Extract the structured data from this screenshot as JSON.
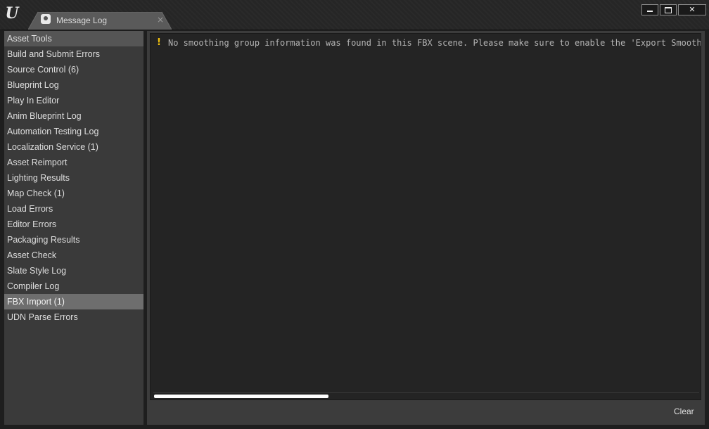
{
  "window": {
    "logo_glyph": "U",
    "logo_icon": "unreal-logo-icon",
    "controls": {
      "minimize_icon": "minimize-icon",
      "maximize_icon": "maximize-icon",
      "close_glyph": "✕"
    }
  },
  "tab": {
    "label": "Message Log",
    "icon": "message-log-icon",
    "close_glyph": "×"
  },
  "sidebar": {
    "items": [
      {
        "label": "Asset Tools",
        "state": "header"
      },
      {
        "label": "Build and Submit Errors",
        "state": "normal"
      },
      {
        "label": "Source Control (6)",
        "state": "normal"
      },
      {
        "label": "Blueprint Log",
        "state": "normal"
      },
      {
        "label": "Play In Editor",
        "state": "normal"
      },
      {
        "label": "Anim Blueprint Log",
        "state": "normal"
      },
      {
        "label": "Automation Testing Log",
        "state": "normal"
      },
      {
        "label": "Localization Service (1)",
        "state": "normal"
      },
      {
        "label": "Asset Reimport",
        "state": "normal"
      },
      {
        "label": "Lighting Results",
        "state": "normal"
      },
      {
        "label": "Map Check (1)",
        "state": "normal"
      },
      {
        "label": "Load Errors",
        "state": "normal"
      },
      {
        "label": "Editor Errors",
        "state": "normal"
      },
      {
        "label": "Packaging Results",
        "state": "normal"
      },
      {
        "label": "Asset Check",
        "state": "normal"
      },
      {
        "label": "Slate Style Log",
        "state": "normal"
      },
      {
        "label": "Compiler Log",
        "state": "normal"
      },
      {
        "label": "FBX Import (1)",
        "state": "selected"
      },
      {
        "label": "UDN Parse Errors",
        "state": "normal"
      }
    ]
  },
  "log": {
    "messages": [
      {
        "severity": "warning",
        "icon_glyph": "!",
        "icon": "warning-icon",
        "text": "No smoothing group information was found in this FBX scene.  Please make sure to enable the 'Export Smoothin"
      }
    ],
    "scroll_position": 0.0,
    "scroll_visible_fraction": 0.32
  },
  "footer": {
    "clear_label": "Clear"
  },
  "colors": {
    "warning": "#f4c20d",
    "selected": "#6e6e6e",
    "header": "#555555"
  }
}
